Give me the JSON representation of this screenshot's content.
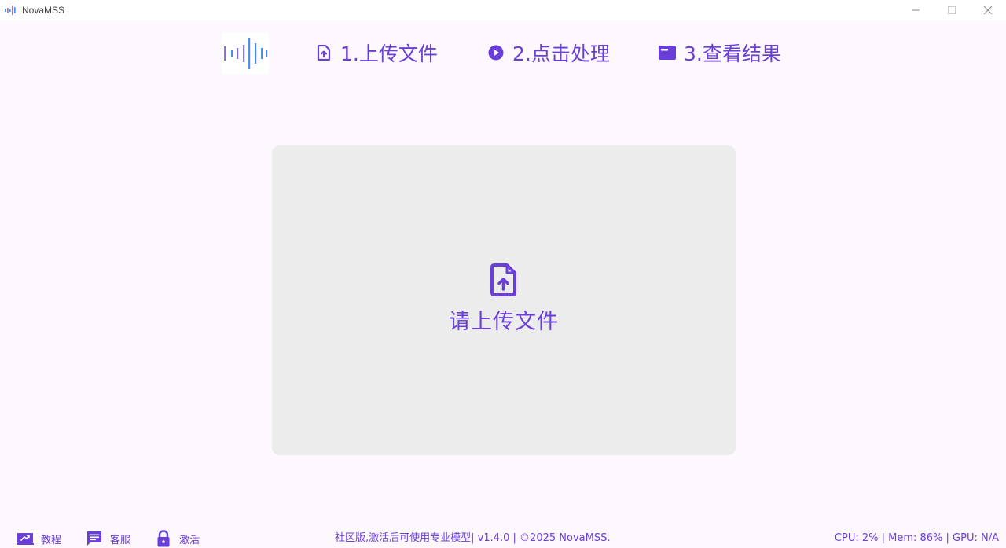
{
  "window": {
    "title": "NovaMSS",
    "controls": [
      "minimize",
      "maximize",
      "close"
    ]
  },
  "steps": [
    {
      "label": "1.上传文件",
      "icon": "file-upload-icon"
    },
    {
      "label": "2.点击处理",
      "icon": "play-circle-icon"
    },
    {
      "label": "3.查看结果",
      "icon": "result-window-icon"
    }
  ],
  "dropzone": {
    "text": "请上传文件",
    "icon": "file-upload-icon"
  },
  "footer": {
    "links": [
      {
        "label": "教程",
        "icon": "tutorial-icon"
      },
      {
        "label": "客服",
        "icon": "chat-icon"
      },
      {
        "label": "激活",
        "icon": "lock-icon"
      }
    ],
    "info": "社区版,激活后可使用专业模型| v1.4.0 | ©2025 NovaMSS.",
    "stats": "CPU: 2% | Mem: 86% | GPU: N/A"
  },
  "colors": {
    "accent": "#6a3fd7",
    "background": "#fdf7fe",
    "dropzone": "#ececec",
    "logo_gradient_start": "#2ab8e8",
    "logo_gradient_end": "#a844e0"
  }
}
